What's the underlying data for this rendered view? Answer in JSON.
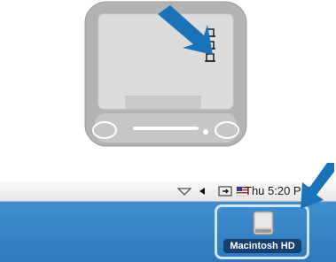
{
  "menubar": {
    "clock": "Thu 5:20 PM",
    "status_icons": [
      "airport-icon",
      "volume-icon",
      "battery-plug-icon",
      "flag-icon"
    ]
  },
  "desktop": {
    "hard_drive_label": "Macintosh HD",
    "background_color": "#3a8ace"
  },
  "colors": {
    "arrow": "#1a73b9",
    "monitor_body": "#b3b3b3",
    "monitor_screen": "#dcdcdc",
    "highlight": "#cfe6f7"
  }
}
